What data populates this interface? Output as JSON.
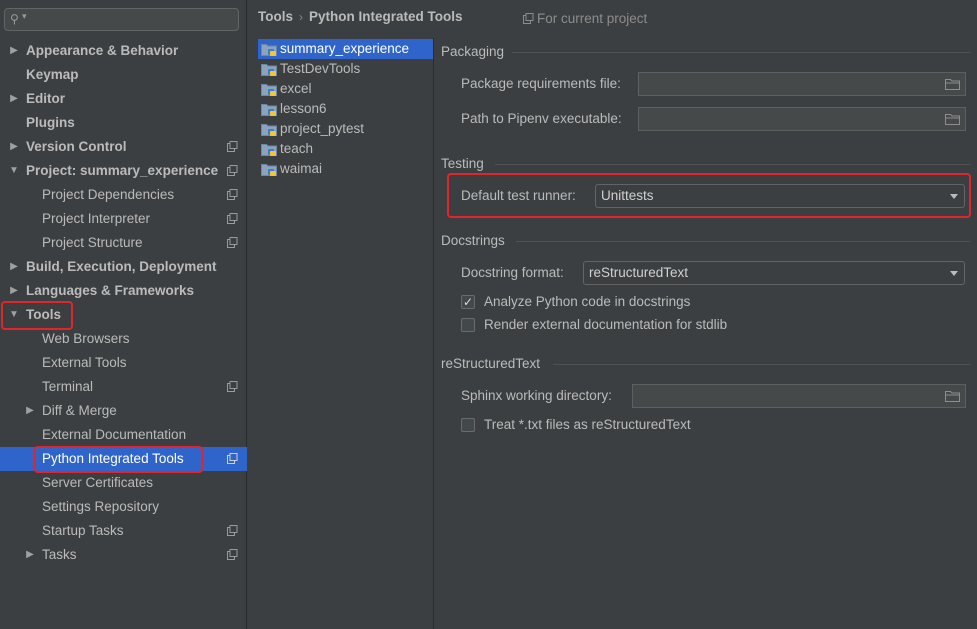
{
  "search": {
    "icon": "search-icon"
  },
  "tree": {
    "items": [
      {
        "label": "Appearance & Behavior",
        "arrow": "▶"
      },
      {
        "label": "Keymap"
      },
      {
        "label": "Editor",
        "arrow": "▶"
      },
      {
        "label": "Plugins"
      },
      {
        "label": "Version Control",
        "arrow": "▶"
      },
      {
        "label": "Project: summary_experience",
        "arrow": "▼"
      },
      {
        "label": "Project Dependencies"
      },
      {
        "label": "Project Interpreter"
      },
      {
        "label": "Project Structure"
      },
      {
        "label": "Build, Execution, Deployment",
        "arrow": "▶"
      },
      {
        "label": "Languages & Frameworks",
        "arrow": "▶"
      },
      {
        "label": "Tools",
        "arrow": "▼"
      },
      {
        "label": "Web Browsers"
      },
      {
        "label": "External Tools"
      },
      {
        "label": "Terminal"
      },
      {
        "label": "Diff & Merge",
        "arrow": "▶"
      },
      {
        "label": "External Documentation"
      },
      {
        "label": "Python Integrated Tools",
        "selected": true
      },
      {
        "label": "Server Certificates"
      },
      {
        "label": "Settings Repository"
      },
      {
        "label": "Startup Tasks"
      },
      {
        "label": "Tasks",
        "arrow": "▶"
      }
    ]
  },
  "header": {
    "breadcrumb_root": "Tools",
    "breadcrumb_separator": "›",
    "breadcrumb_current": "Python Integrated Tools",
    "scope_text": "For current project"
  },
  "projects": {
    "items": [
      {
        "name": "summary_experience",
        "selected": true
      },
      {
        "name": "TestDevTools"
      },
      {
        "name": "excel"
      },
      {
        "name": "lesson6"
      },
      {
        "name": "project_pytest"
      },
      {
        "name": "teach"
      },
      {
        "name": "waimai"
      }
    ]
  },
  "packaging": {
    "title": "Packaging",
    "requirements_label": "Package requirements file:",
    "requirements_value": "",
    "pipenv_label": "Path to Pipenv executable:",
    "pipenv_value": ""
  },
  "testing": {
    "title": "Testing",
    "runner_label": "Default test runner:",
    "runner_value": "Unittests"
  },
  "docstrings": {
    "title": "Docstrings",
    "format_label": "Docstring format:",
    "format_value": "reStructuredText",
    "analyze_label": "Analyze Python code in docstrings",
    "analyze_checked": true,
    "render_label": "Render external documentation for stdlib",
    "render_checked": false
  },
  "restructuredtext": {
    "title": "reStructuredText",
    "sphinx_label": "Sphinx working directory:",
    "sphinx_value": "",
    "txt_label": "Treat *.txt files as reStructuredText",
    "txt_checked": false
  },
  "colors": {
    "selection": "#2f65ca",
    "highlight_box": "#e0262b",
    "background": "#3c3f41"
  }
}
